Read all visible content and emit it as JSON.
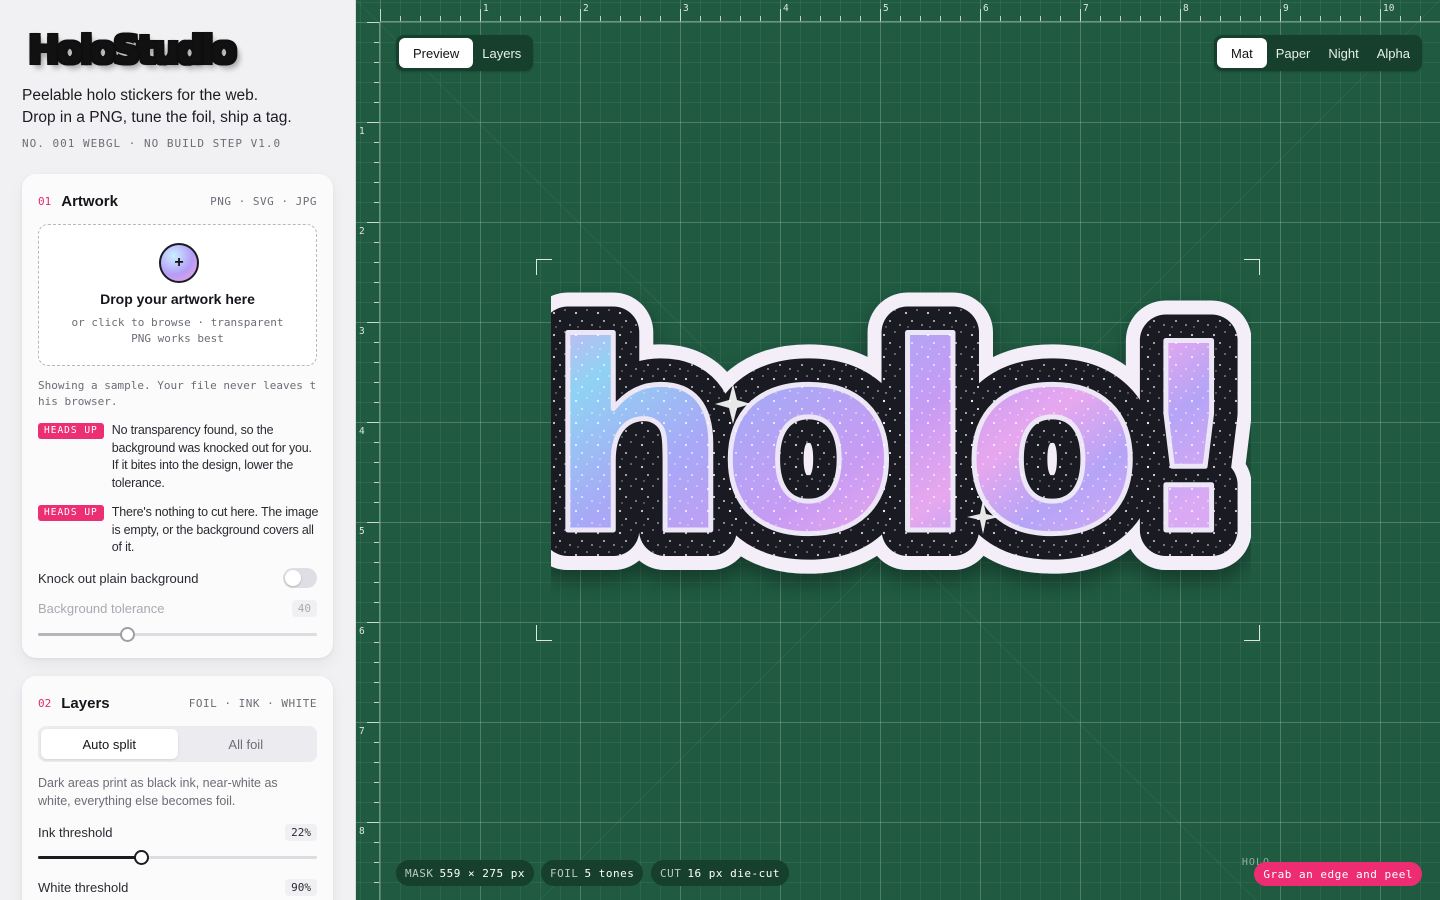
{
  "brand": {
    "logo": "HoloStudio",
    "tagline_1": "Peelable holo stickers for the web.",
    "tagline_2": "Drop in a PNG, tune the foil, ship a tag.",
    "meta": "NO. 001 WEBGL · NO BUILD STEP V1.0"
  },
  "artwork": {
    "num": "01",
    "title": "Artwork",
    "formats": "PNG · SVG · JPG",
    "drop_title": "Drop your artwork here",
    "drop_sub": "or click to browse · transparent PNG works best",
    "sample_note": "Showing a sample. Your file never leaves this browser.",
    "notices": [
      {
        "badge": "HEADS UP",
        "text": "No transparency found, so the background was knocked out for you. If it bites into the design, lower the tolerance."
      },
      {
        "badge": "HEADS UP",
        "text": "There's nothing to cut here. The image is empty, or the background covers all of it."
      }
    ],
    "knockout_label": "Knock out plain background",
    "knockout_on": false,
    "tolerance_label": "Background tolerance",
    "tolerance_value": "40",
    "tolerance_fraction": 0.32
  },
  "layers": {
    "num": "02",
    "title": "Layers",
    "kinds": "FOIL · INK · WHITE",
    "modes": [
      "Auto split",
      "All foil"
    ],
    "active_mode": 0,
    "description": "Dark areas print as black ink, near-white as white, everything else becomes foil.",
    "ink_label": "Ink threshold",
    "ink_value": "22%",
    "ink_fraction": 0.37,
    "white_label": "White threshold",
    "white_value": "90%"
  },
  "canvas": {
    "view_tabs": [
      "Preview",
      "Layers"
    ],
    "active_view": 0,
    "backgrounds": [
      "Mat",
      "Paper",
      "Night",
      "Alpha"
    ],
    "active_background": 0,
    "ruler_numbers": [
      "1",
      "2",
      "3",
      "4",
      "5",
      "6",
      "7",
      "8",
      "9",
      "10"
    ],
    "ruler_numbers_v": [
      "1",
      "2",
      "3",
      "4",
      "5",
      "6",
      "7",
      "8"
    ],
    "sticker_text": "holo!",
    "mat_color": "#1f5a41",
    "accent_color": "#ee2c72",
    "chips": {
      "mask_key": "MASK",
      "mask_val": "559 × 275 px",
      "foil_key": "FOIL",
      "foil_val": "5 tones",
      "cut_key": "CUT",
      "cut_val": "16 px die-cut"
    },
    "watermark": "HOLO",
    "peel_hint": "Grab an edge and peel"
  }
}
